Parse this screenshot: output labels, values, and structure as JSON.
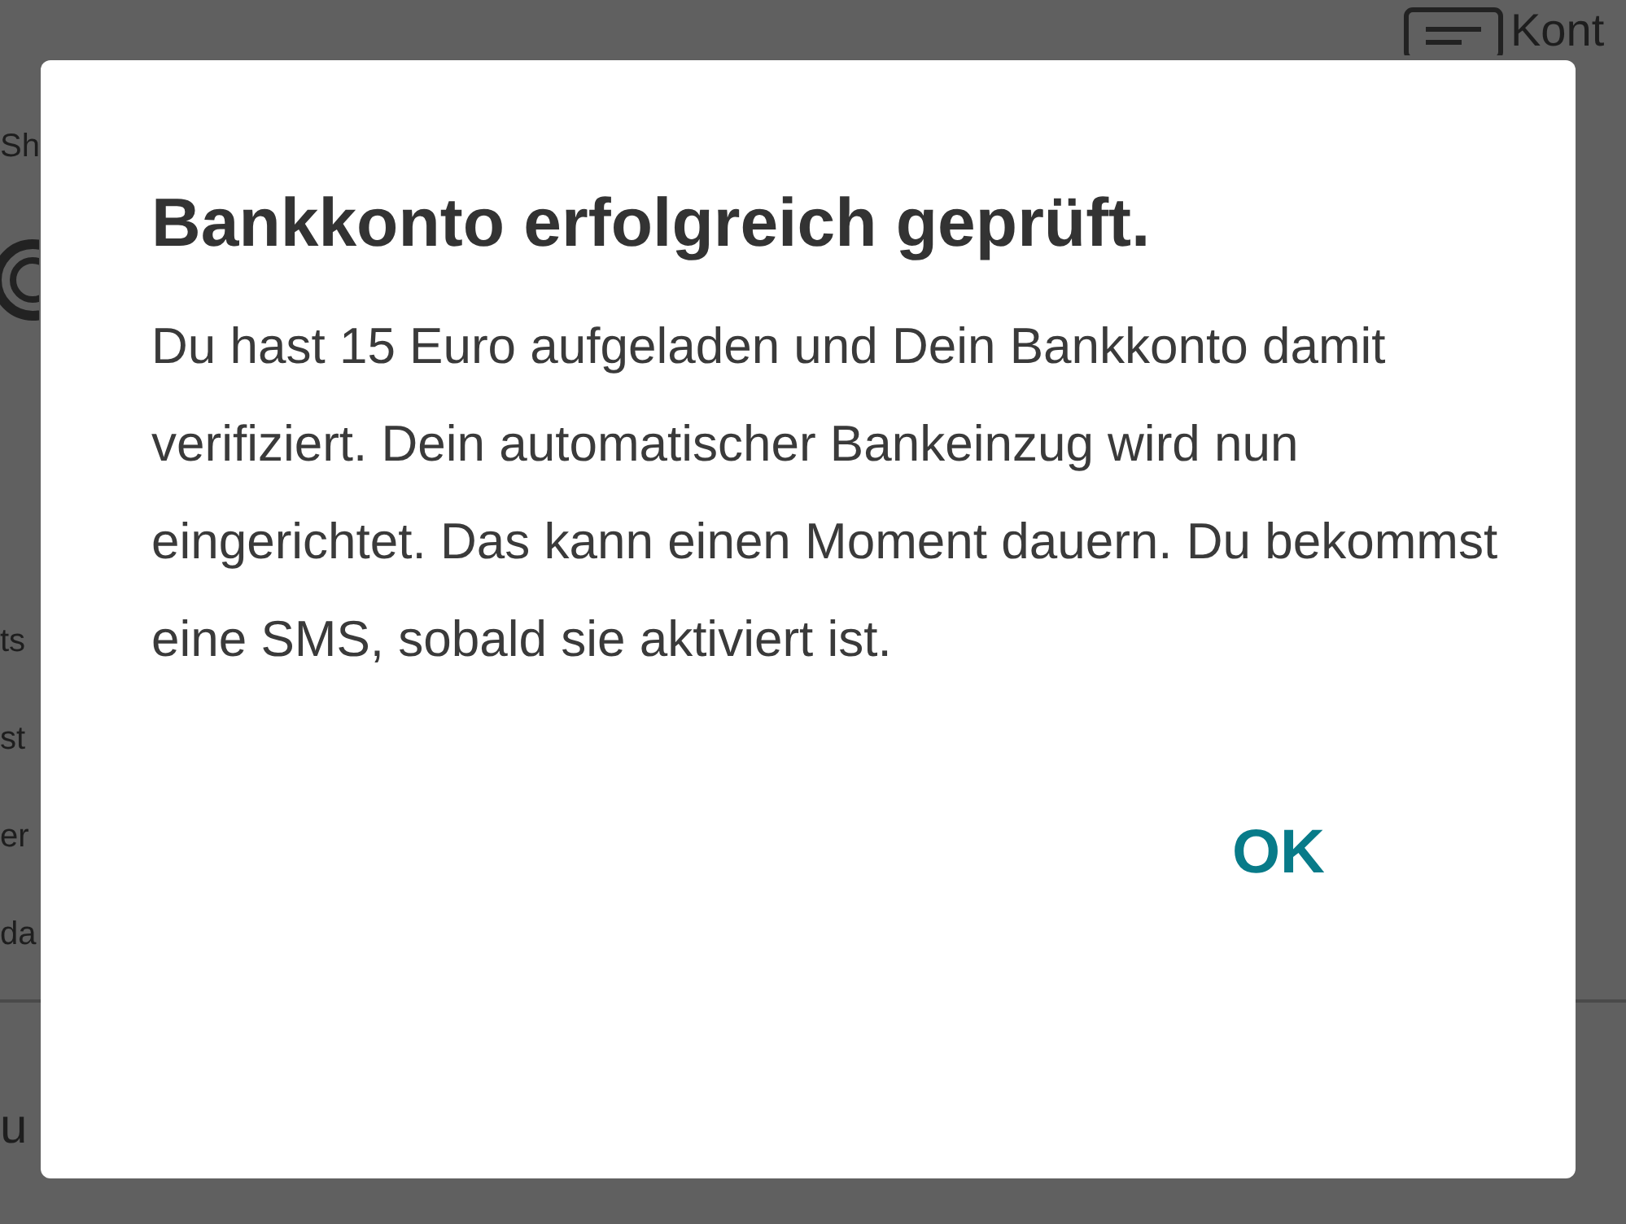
{
  "background": {
    "left_fragments": [
      "Sh",
      "ts",
      "st",
      "er",
      "da",
      "u"
    ],
    "header_fragment": "Kont"
  },
  "dialog": {
    "title": "Bankkonto erfolgreich geprüft.",
    "message": "Du hast 15 Euro aufgeladen und Dein Bankkonto damit verifiziert. Dein automatischer Bankeinzug wird nun eingerichtet. Das kann einen Moment dauern. Du bekommst eine SMS, sobald sie aktiviert ist.",
    "buttons": [
      "OK"
    ]
  }
}
